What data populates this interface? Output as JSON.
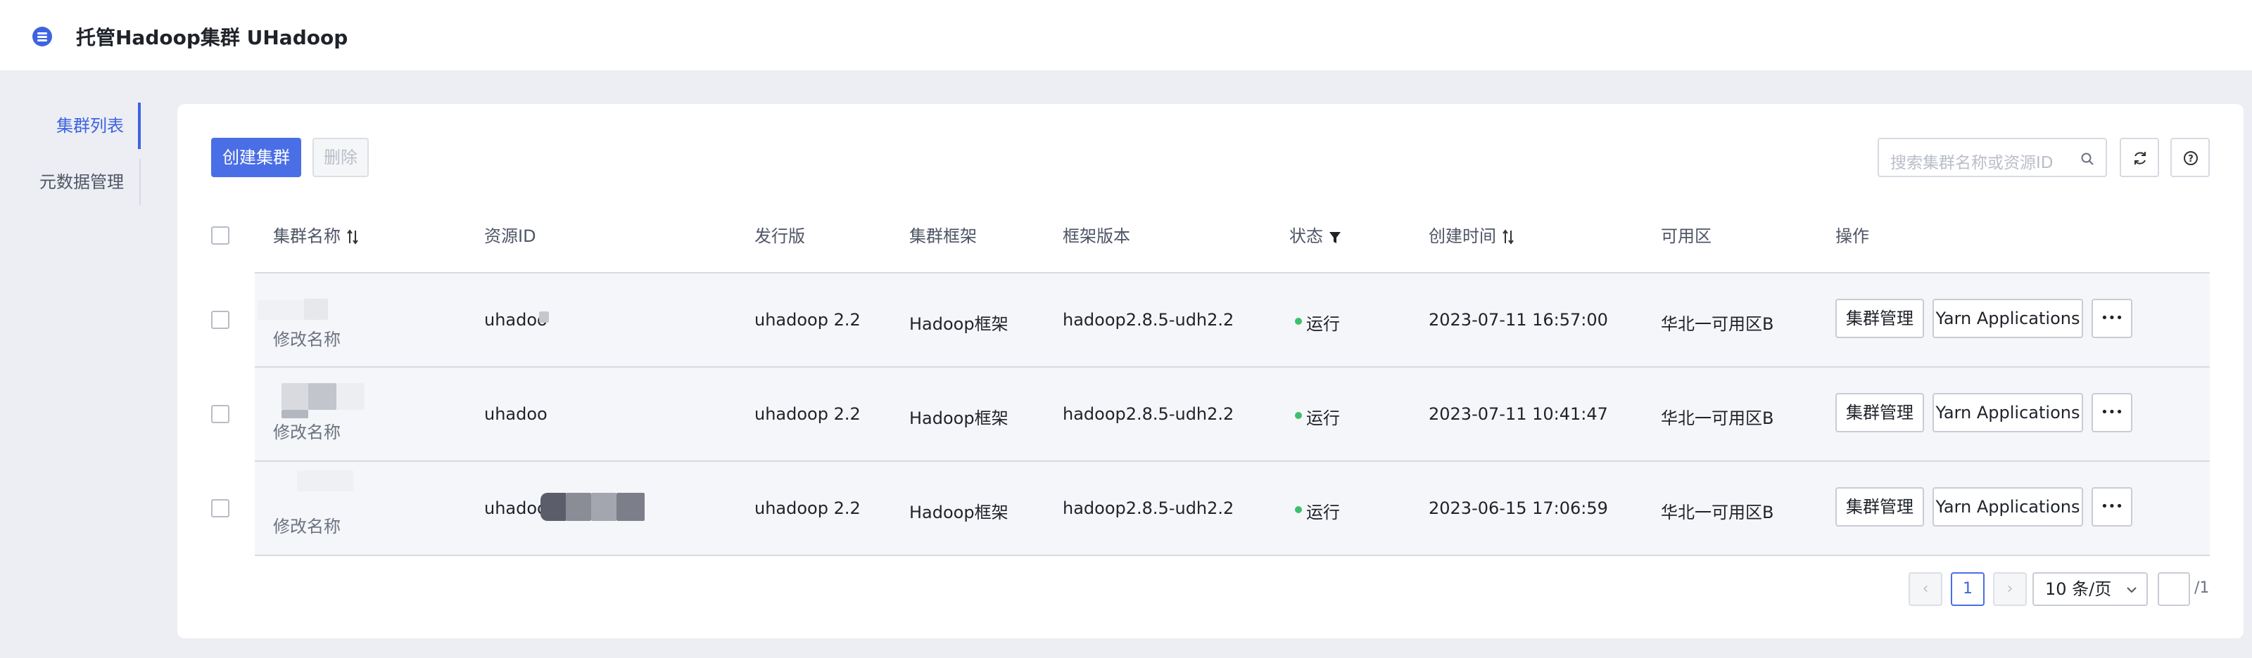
{
  "app": {
    "title": "托管Hadoop集群 UHadoop"
  },
  "sidebar": {
    "items": [
      {
        "label": "集群列表",
        "active": true
      },
      {
        "label": "元数据管理",
        "active": false
      }
    ]
  },
  "toolbar": {
    "create_label": "创建集群",
    "delete_label": "删除",
    "search_placeholder": "搜索集群名称或资源ID"
  },
  "table": {
    "columns": [
      "集群名称",
      "资源ID",
      "发行版",
      "集群框架",
      "框架版本",
      "状态",
      "创建时间",
      "可用区",
      "操作"
    ],
    "rename_label": "修改名称",
    "actions": {
      "manage": "集群管理",
      "yarn": "Yarn Applications",
      "more": "•••"
    },
    "rows": [
      {
        "resource_id": "uhadoo",
        "release": "uhadoop 2.2",
        "framework": "Hadoop框架",
        "framework_version": "hadoop2.8.5-udh2.2",
        "status": "运行",
        "created": "2023-07-11 16:57:00",
        "zone": "华北一可用区B"
      },
      {
        "resource_id": "uhadoo",
        "release": "uhadoop 2.2",
        "framework": "Hadoop框架",
        "framework_version": "hadoop2.8.5-udh2.2",
        "status": "运行",
        "created": "2023-07-11 10:41:47",
        "zone": "华北一可用区B"
      },
      {
        "resource_id": "uhadoo",
        "release": "uhadoop 2.2",
        "framework": "Hadoop框架",
        "framework_version": "hadoop2.8.5-udh2.2",
        "status": "运行",
        "created": "2023-06-15 17:06:59",
        "zone": "华北一可用区B"
      }
    ]
  },
  "pagination": {
    "prev": "‹",
    "current_page": "1",
    "next": "›",
    "page_size_label": "10 条/页",
    "total_pages": "/1"
  },
  "colors": {
    "accent": "#3f63e0",
    "status_running": "#3fbf6a"
  }
}
